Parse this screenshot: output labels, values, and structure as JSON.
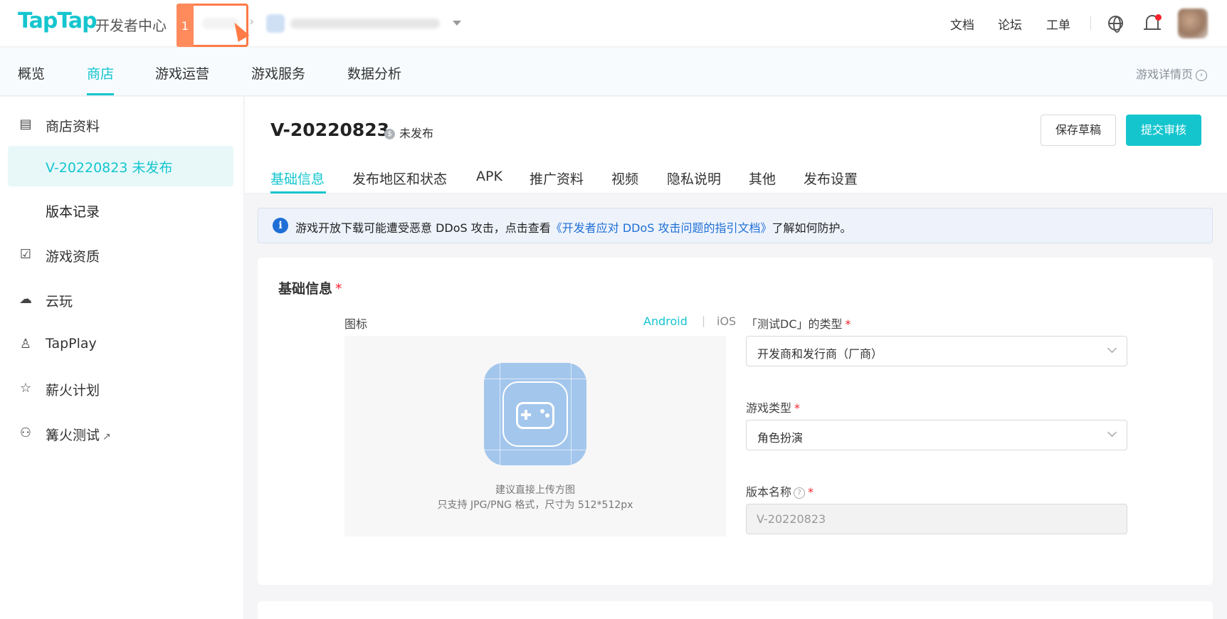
{
  "topbar": {
    "logo": "TapTap",
    "logo_sub": "开发者中心",
    "highlight_number": "1",
    "links": [
      "文档",
      "论坛",
      "工单"
    ]
  },
  "nav": {
    "items": [
      "概览",
      "商店",
      "游戏运营",
      "游戏服务",
      "数据分析"
    ],
    "active": "商店",
    "right_link": "游戏详情页"
  },
  "sidebar": {
    "items": [
      {
        "label": "商店资料",
        "icon": "store-icon"
      },
      {
        "label": "V-20220823 未发布",
        "sub": true,
        "active": true
      },
      {
        "label": "版本记录",
        "sub": true
      },
      {
        "label": "游戏资质",
        "icon": "clipboard-check-icon"
      },
      {
        "label": "云玩",
        "icon": "cloud-icon"
      },
      {
        "label": "TapPlay",
        "icon": "tapplay-icon"
      },
      {
        "label": "薪火计划",
        "icon": "star-icon"
      },
      {
        "label": "篝火测试",
        "icon": "users-icon",
        "external": true
      }
    ]
  },
  "header": {
    "version_title": "V-20220823",
    "status": "未发布",
    "save_draft": "保存草稿",
    "submit_review": "提交审核"
  },
  "tabs": [
    "基础信息",
    "发布地区和状态",
    "APK",
    "推广资料",
    "视频",
    "隐私说明",
    "其他",
    "发布设置"
  ],
  "notice": {
    "text_before": "游戏开放下载可能遭受恶意 DDoS 攻击，点击查看",
    "link": "《开发者应对 DDoS 攻击问题的指引文档》",
    "text_after": "了解如何防护。"
  },
  "basic_info": {
    "section_title": "基础信息",
    "required_mark": "*",
    "icon_label": "图标",
    "platform_android": "Android",
    "platform_ios": "iOS",
    "upload_hint_1": "建议直接上传方图",
    "upload_hint_2": "只支持 JPG/PNG 格式，尺寸为 512*512px",
    "type_label": "「测试DC」的类型",
    "type_value": "开发商和发行商（厂商）",
    "genre_label": "游戏类型",
    "genre_value": "角色扮演",
    "version_name_label": "版本名称",
    "version_name_value": "V-20220823"
  },
  "colors": {
    "accent": "#15c5ce",
    "link": "#1f6fd6",
    "required": "#f5222d",
    "highlight": "#ff7a45"
  }
}
